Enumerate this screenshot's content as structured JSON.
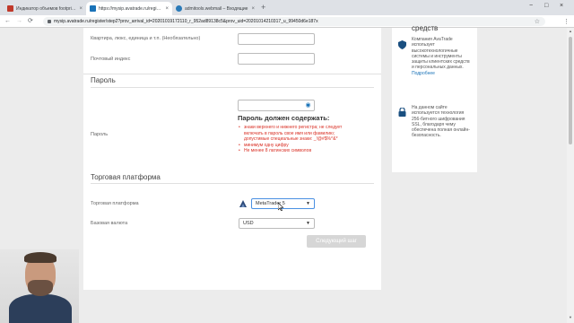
{
  "browser": {
    "tabs": [
      {
        "label": "Индикатор объемов footprint - ...",
        "favicon_color": "#c0392b",
        "active": false
      },
      {
        "label": "https://mysip.avatrade.ru/regist...",
        "favicon_color": "#1a73b8",
        "active": true
      },
      {
        "label": "admitools.webmail – Входящие",
        "favicon_color": "#2a7ab8",
        "active": false
      }
    ],
    "tab_close_icon": "×",
    "new_tab_icon": "+",
    "url": "mysip.avatrade.ru/register/step2?prov_arrival_id=20201019172110_r_952ad89138c5&prov_uid=20201014210317_u_99450d6e187x",
    "window": {
      "minimize": "−",
      "maximize": "□",
      "close": "×"
    }
  },
  "form": {
    "address_label": "Квартира, люкс, единица и т.п. (Необязательно)",
    "postal_label": "Почтовый индекс",
    "password_section": "Пароль",
    "password_label": "Пароль",
    "password_value": "",
    "password_requirements_title": "Пароль должен содержать:",
    "password_rules": [
      "знаки верхнего и нижнего регистра; не следует включать в пароль свое имя или фамилию; допустимые специальные знаки: _!@#$%^&*",
      "минимум одну цифру",
      "Не менее 8 латинских символов"
    ],
    "platform_section": "Торговая платформа",
    "platform_label": "Торговая платформа",
    "platform_value": "MetaTrader 5",
    "currency_label": "Базовая валюта",
    "currency_value": "USD",
    "next_button": "Следующий шаг"
  },
  "sidebar": {
    "title": "средств",
    "text": "Компания AvaTrade использует высокотехнологичные системы и инструменты защиты клиентских средств и персональных данных.",
    "link": "Подробнее",
    "ssl_text": "На данном сайте используется технология 256-битного шифрования SSL, благодаря чему обеспечена полная онлайн-безопасность."
  },
  "colors": {
    "accent": "#1a73b8",
    "error": "#d93025",
    "disabled_button": "#d6d6d6"
  }
}
